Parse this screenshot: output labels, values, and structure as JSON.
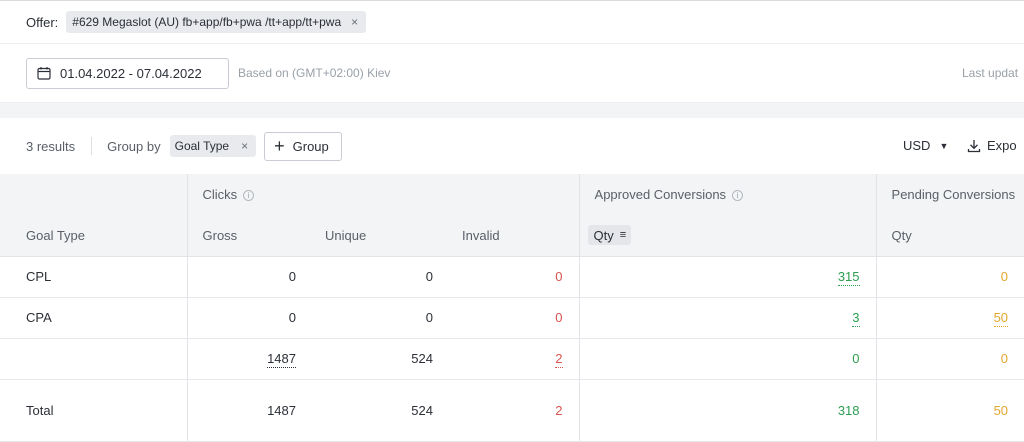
{
  "offer": {
    "label": "Offer:",
    "chip_text": "#629 Megaslot (AU) fb+app/fb+pwa /tt+app/tt+pwa",
    "chip_close": "×"
  },
  "date": {
    "range": "01.04.2022 - 07.04.2022",
    "timezone": "Based on (GMT+02:00) Kiev",
    "last_update": "Last updat"
  },
  "toolbar": {
    "results": "3 results",
    "group_by_label": "Group by",
    "group_chip": "Goal Type",
    "group_chip_close": "×",
    "group_button_plus": "+",
    "group_button": "Group",
    "currency": "USD",
    "currency_chevron": "⌄",
    "export": "Expo"
  },
  "table": {
    "groups": {
      "clicks": "Clicks",
      "approved": "Approved Conversions",
      "pending": "Pending Conversions"
    },
    "info_glyph": "i",
    "sort_glyph": "≡",
    "columns": {
      "goal_type": "Goal Type",
      "gross": "Gross",
      "unique": "Unique",
      "invalid": "Invalid",
      "approved_qty": "Qty",
      "pending_qty": "Qty"
    },
    "rows": [
      {
        "goal": "CPL",
        "gross": "0",
        "unique": "0",
        "invalid": "0",
        "approved": "315",
        "pending": "0"
      },
      {
        "goal": "CPA",
        "gross": "0",
        "unique": "0",
        "invalid": "0",
        "approved": "3",
        "pending": "50"
      },
      {
        "goal": "",
        "gross": "1487",
        "unique": "524",
        "invalid": "2",
        "approved": "0",
        "pending": "0"
      }
    ],
    "total": {
      "label": "Total",
      "gross": "1487",
      "unique": "524",
      "invalid": "2",
      "approved": "318",
      "pending": "50"
    }
  },
  "colors": {
    "invalid": "#d9534f",
    "approved": "#2e9e50",
    "pending": "#e3a72f"
  }
}
